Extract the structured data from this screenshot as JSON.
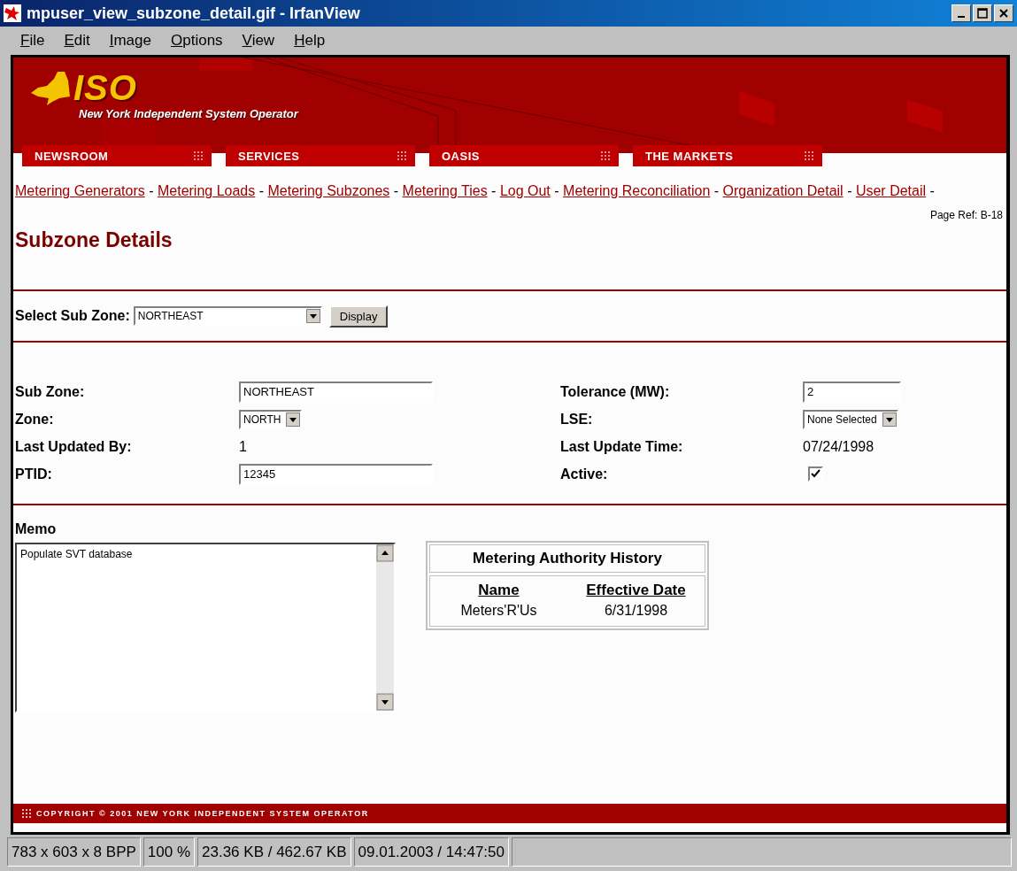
{
  "window": {
    "title": "mpuser_view_subzone_detail.gif - IrfanView"
  },
  "menu": [
    {
      "label": "File"
    },
    {
      "label": "Edit"
    },
    {
      "label": "Image"
    },
    {
      "label": "Options"
    },
    {
      "label": "View"
    },
    {
      "label": "Help"
    }
  ],
  "header": {
    "logo_text": "ISO",
    "tagline": "New York Independent System Operator"
  },
  "nav_tabs": [
    {
      "label": "NEWSROOM"
    },
    {
      "label": "SERVICES"
    },
    {
      "label": "OASIS"
    },
    {
      "label": "THE MARKETS"
    }
  ],
  "links": {
    "separator": "-",
    "items": [
      "Metering Generators",
      "Metering Loads",
      "Metering Subzones",
      "Metering Ties",
      "Log Out",
      "Metering Reconciliation",
      "Organization Detail",
      "User Detail"
    ]
  },
  "page_ref": "Page Ref: B-18",
  "heading": "Subzone Details",
  "selector": {
    "label": "Select Sub Zone:",
    "value": "NORTHEAST",
    "button": "Display"
  },
  "fields_left": [
    {
      "kind": "text",
      "label": "Sub Zone:",
      "value": "NORTHEAST"
    },
    {
      "kind": "select",
      "label": "Zone:",
      "value": "NORTH"
    },
    {
      "kind": "static",
      "label": "Last Updated By:",
      "value": "1"
    },
    {
      "kind": "text",
      "label": "PTID:",
      "value": "12345"
    }
  ],
  "fields_right": [
    {
      "kind": "text",
      "label": "Tolerance (MW):",
      "value": "2"
    },
    {
      "kind": "select",
      "label": "LSE:",
      "value": "None Selected"
    },
    {
      "kind": "static",
      "label": "Last Update Time:",
      "value": "07/24/1998"
    },
    {
      "kind": "checkbox",
      "label": "Active:",
      "checked": true
    }
  ],
  "memo": {
    "label": "Memo",
    "value": "Populate SVT database"
  },
  "history": {
    "title": "Metering Authority History",
    "columns": [
      "Name",
      "Effective Date"
    ],
    "rows": [
      [
        "Meters'R'Us",
        "6/31/1998"
      ]
    ]
  },
  "footer": "COPYRIGHT © 2001 NEW YORK INDEPENDENT SYSTEM OPERATOR",
  "status_bar": [
    "783 x 603 x 8 BPP",
    "100 %",
    "23.36 KB / 462.67 KB",
    "09.01.2003 / 14:47:50"
  ]
}
